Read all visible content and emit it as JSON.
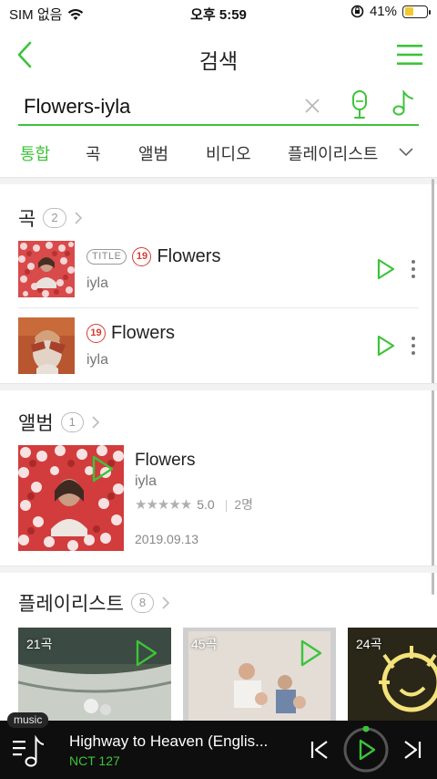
{
  "status_bar": {
    "carrier": "SIM 없음",
    "time": "오후 5:59",
    "battery_percent": "41%",
    "battery_level": 0.41
  },
  "header": {
    "title": "검색"
  },
  "search": {
    "query": "Flowers-iyla"
  },
  "tabs": [
    {
      "label": "통합",
      "active": true
    },
    {
      "label": "곡",
      "active": false
    },
    {
      "label": "앨범",
      "active": false
    },
    {
      "label": "비디오",
      "active": false
    },
    {
      "label": "플레이리스트",
      "active": false
    }
  ],
  "songs_section": {
    "label": "곡",
    "count": "2",
    "items": [
      {
        "title_badge": "TITLE",
        "age": "19",
        "title": "Flowers",
        "artist": "iyla"
      },
      {
        "age": "19",
        "title": "Flowers",
        "artist": "iyla"
      }
    ]
  },
  "albums_section": {
    "label": "앨범",
    "count": "1",
    "album": {
      "title": "Flowers",
      "artist": "iyla",
      "rating_stars": 5,
      "rating": "5.0",
      "raters": "2명",
      "date": "2019.09.13"
    }
  },
  "playlists_section": {
    "label": "플레이리스트",
    "count": "8",
    "items": [
      {
        "count": "21곡"
      },
      {
        "count": "45곡"
      },
      {
        "count": "24곡"
      }
    ]
  },
  "player": {
    "tag": "music",
    "title": "Highway to Heaven (Englis...",
    "artist": "NCT 127"
  },
  "colors": {
    "accent": "#3dc33a",
    "age_badge": "#d83a2f",
    "player_bg": "#0e0e0e"
  }
}
